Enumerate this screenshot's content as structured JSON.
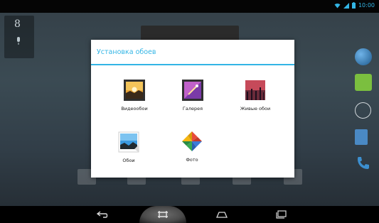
{
  "status_bar": {
    "time": "10:00"
  },
  "dialog": {
    "title": "Установка обоев",
    "options": [
      {
        "label": "Видеообои",
        "icon": "video-wallpaper-icon"
      },
      {
        "label": "Галерея",
        "icon": "gallery-icon"
      },
      {
        "label": "Живые обои",
        "icon": "live-wallpaper-icon"
      },
      {
        "label": "Обои",
        "icon": "wallpapers-icon"
      },
      {
        "label": "Фото",
        "icon": "photos-icon"
      }
    ]
  },
  "colors": {
    "accent": "#33b5e5",
    "dialog_bg": "#ffffff",
    "nav_bg": "#000000"
  }
}
